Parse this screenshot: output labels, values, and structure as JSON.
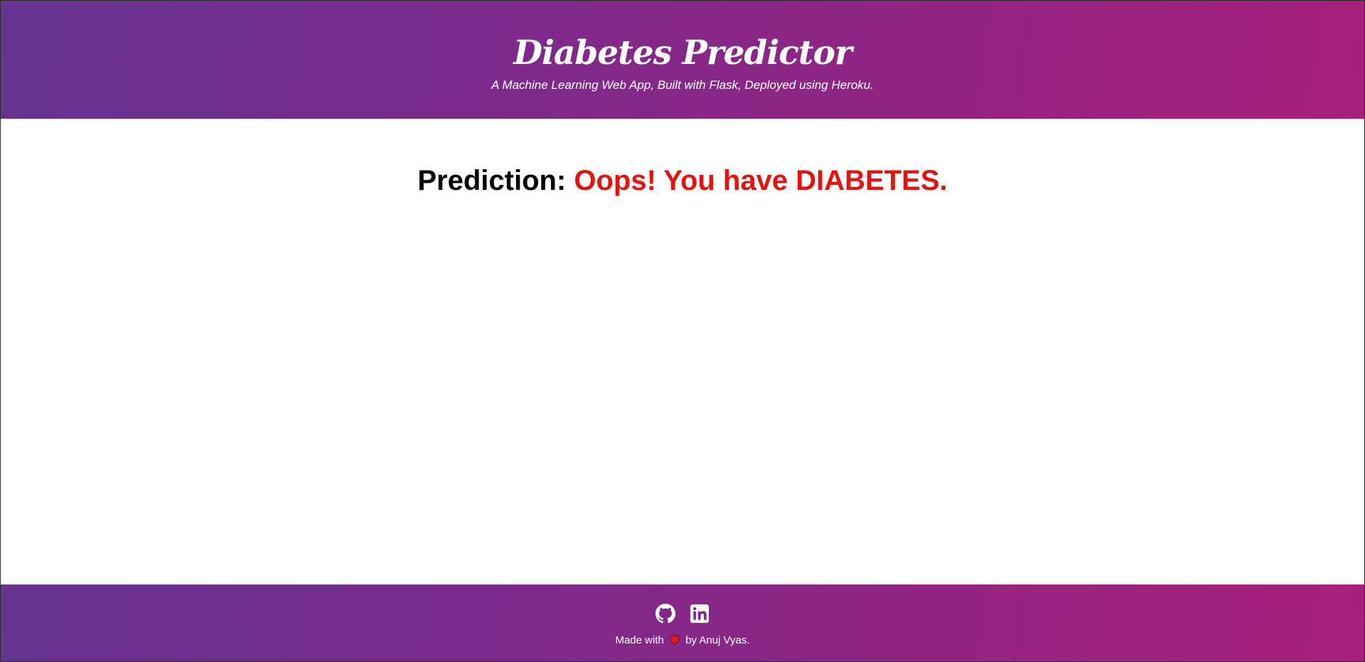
{
  "header": {
    "title": "Diabetes Predictor",
    "subtitle": "A Machine Learning Web App, Built with Flask, Deployed using Heroku."
  },
  "main": {
    "prediction_label": "Prediction:",
    "prediction_result": "Oops! You have DIABETES."
  },
  "footer": {
    "social_icons": [
      "github-icon",
      "linkedin-icon"
    ],
    "credit_prefix": "Made with",
    "heart_icon": "heart-icon",
    "credit_suffix": "by Anuj Vyas."
  },
  "colors": {
    "gradient_start": "#653490",
    "gradient_end": "#a81f7c",
    "prediction_result": "#e3130f",
    "heart": "#e0191f"
  }
}
